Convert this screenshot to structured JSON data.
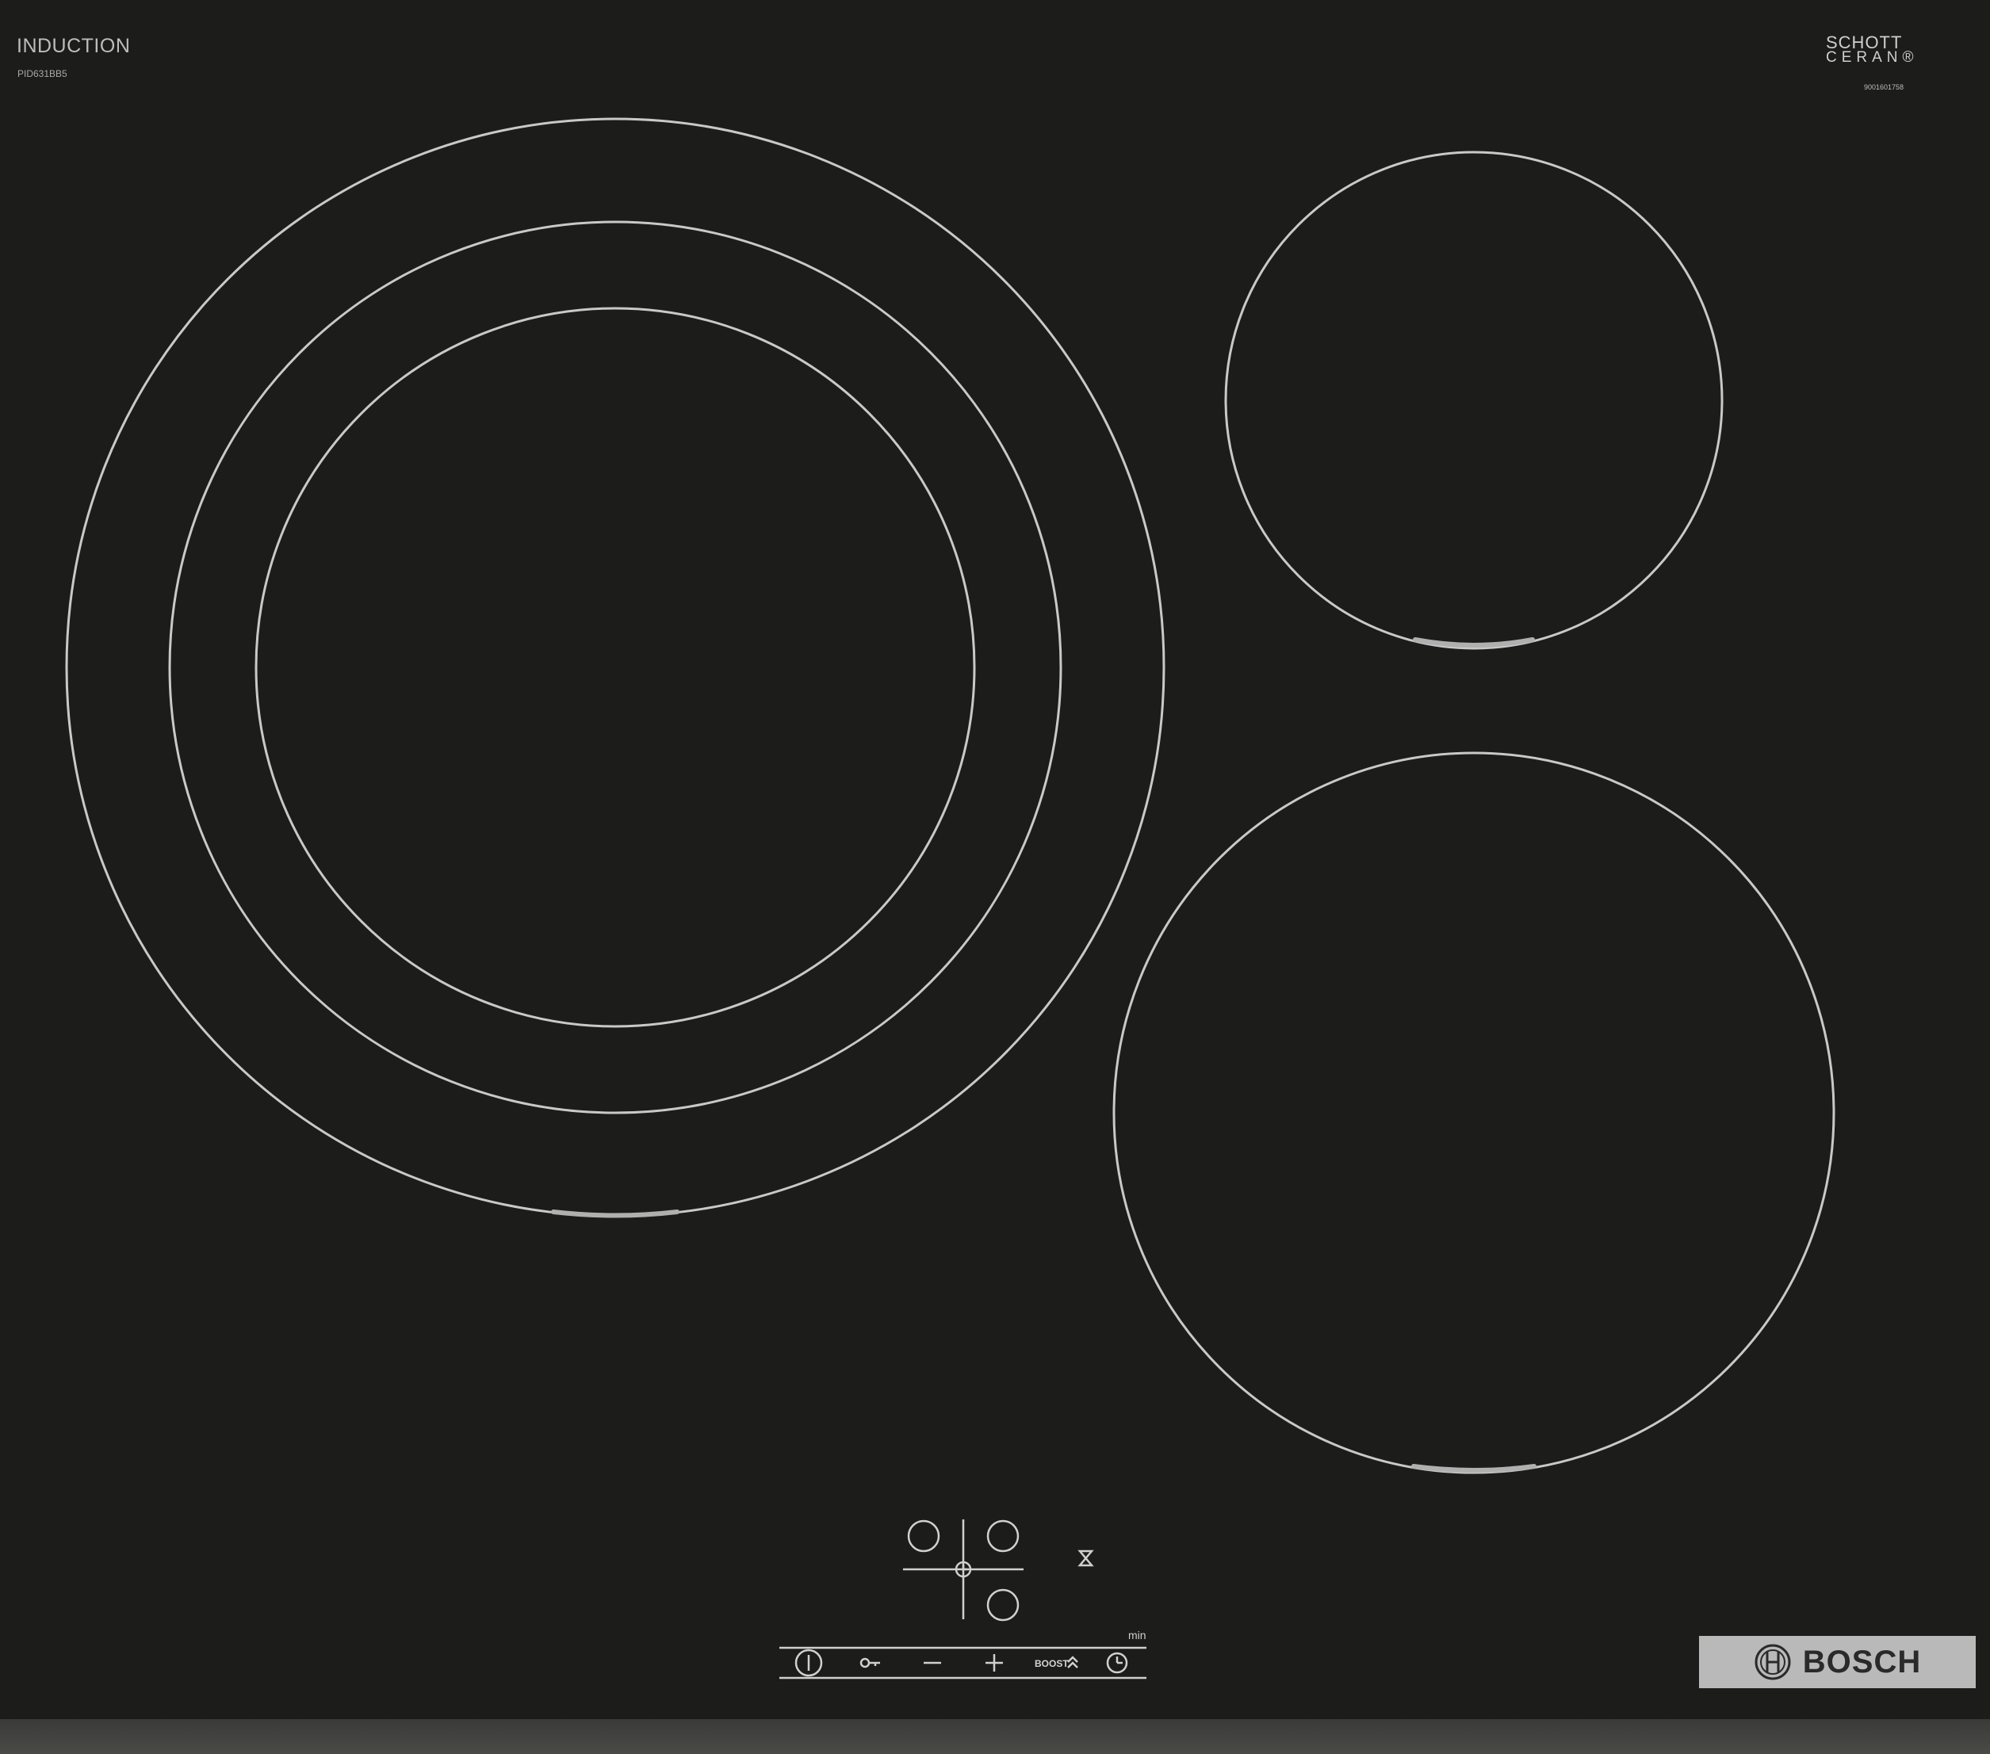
{
  "header": {
    "brand_line": "INDUCTION",
    "model": "PID631BB5"
  },
  "glass_logo": {
    "line1": "SCHOTT",
    "line2": "CERAN®",
    "serial": "9001601758"
  },
  "controls": {
    "timer_unit": "min",
    "buttons": [
      {
        "name": "power",
        "icon": "power-icon"
      },
      {
        "name": "lock",
        "icon": "key-lock-icon"
      },
      {
        "name": "minus",
        "icon": "minus-icon"
      },
      {
        "name": "plus",
        "icon": "plus-icon"
      },
      {
        "name": "boost",
        "label": "BOOST",
        "icon": "double-chevron-up-icon"
      },
      {
        "name": "timer",
        "icon": "clock-icon"
      }
    ]
  },
  "brand_badge": {
    "label": "BOSCH",
    "icon": "bosch-armature-icon"
  },
  "colors": {
    "glass": "#1c1c1b",
    "markings": "#c9c9c9",
    "badge": "#b9b9b9"
  }
}
